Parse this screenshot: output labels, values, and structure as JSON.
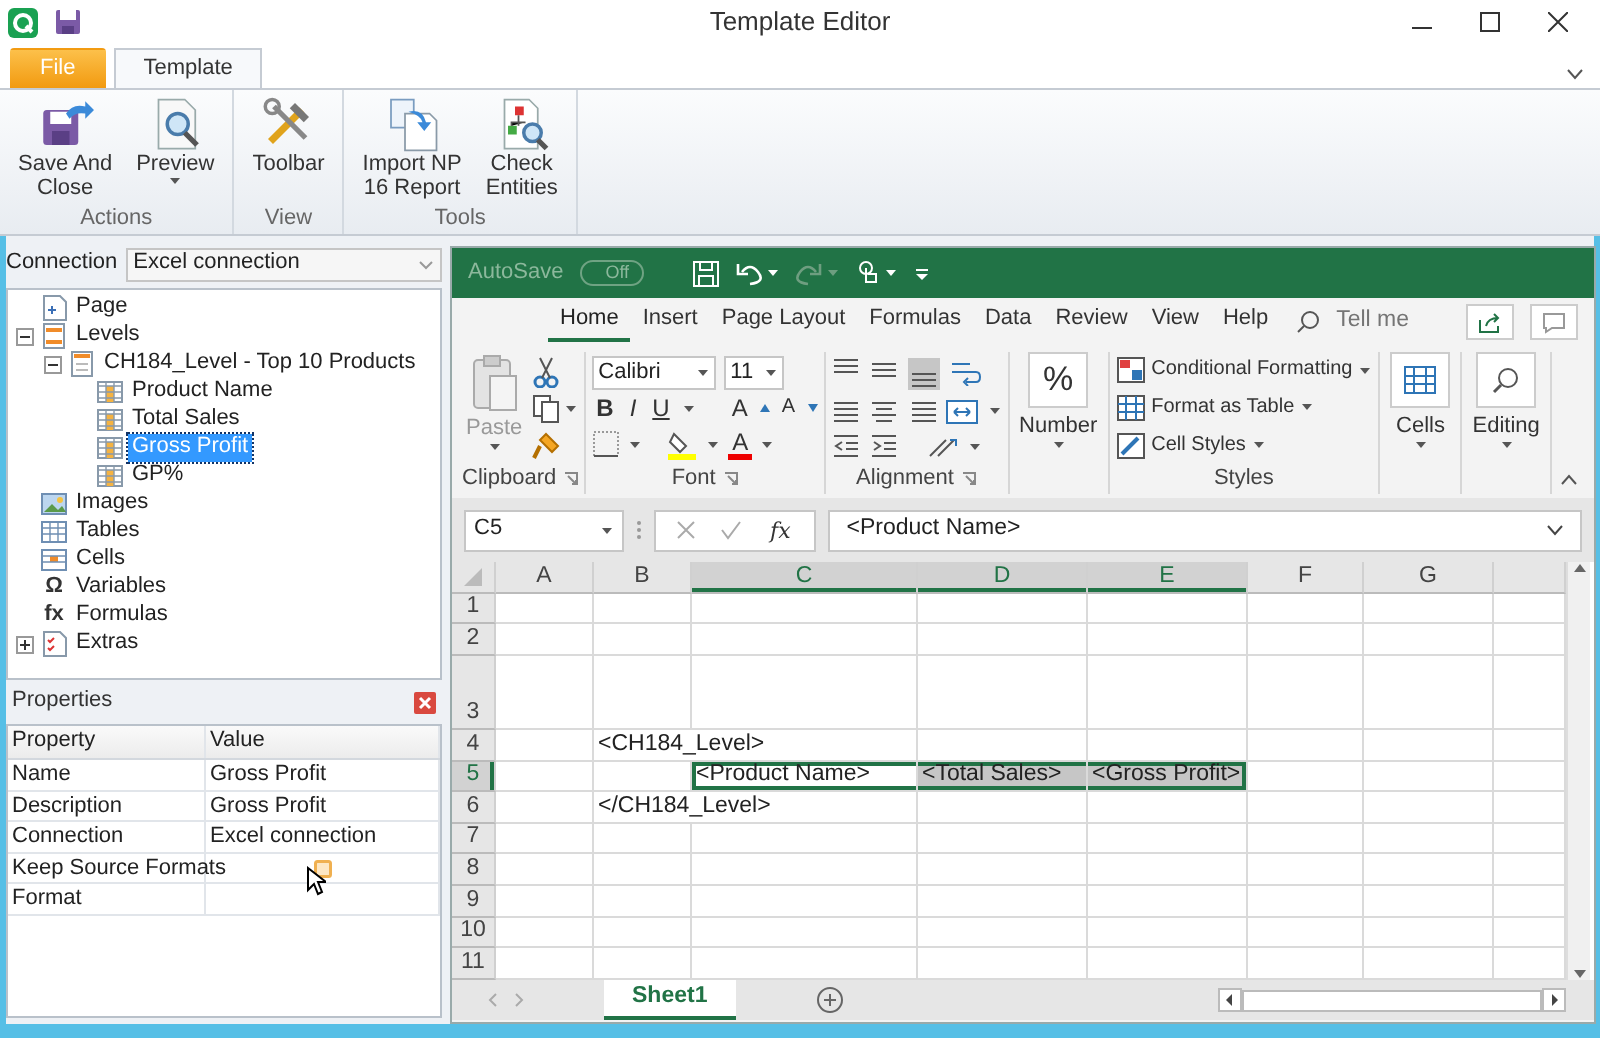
{
  "window": {
    "title": "Template Editor"
  },
  "ribbon": {
    "tabs": [
      {
        "label": "File",
        "kind": "file",
        "selected": false
      },
      {
        "label": "Template",
        "kind": "tab",
        "selected": true
      }
    ],
    "groups": [
      {
        "label": "Actions",
        "buttons": [
          {
            "label": "Save And\nClose",
            "kind": "save-close",
            "dropdown": false
          },
          {
            "label": "Preview",
            "kind": "preview",
            "dropdown": true
          }
        ]
      },
      {
        "label": "View",
        "buttons": [
          {
            "label": "Toolbar",
            "kind": "toolbar",
            "dropdown": false
          }
        ]
      },
      {
        "label": "Tools",
        "buttons": [
          {
            "label": "Import NP\n16 Report",
            "kind": "import",
            "dropdown": false
          },
          {
            "label": "Check\nEntities",
            "kind": "check",
            "dropdown": false
          }
        ]
      }
    ]
  },
  "connection": {
    "label": "Connection",
    "value": "Excel connection"
  },
  "tree": [
    {
      "label": "Page",
      "kind": "page",
      "selected": false
    },
    {
      "label": "Levels",
      "kind": "levels",
      "selected": false,
      "expanded": true,
      "children": [
        {
          "label": "CH184_Level - Top 10 Products",
          "kind": "level",
          "selected": false,
          "expanded": true,
          "children": [
            {
              "label": "Product Name",
              "kind": "field",
              "selected": false
            },
            {
              "label": "Total Sales",
              "kind": "field",
              "selected": false
            },
            {
              "label": "Gross Profit",
              "kind": "field",
              "selected": true
            },
            {
              "label": "GP%",
              "kind": "field",
              "selected": false
            }
          ]
        }
      ]
    },
    {
      "label": "Images",
      "kind": "images",
      "selected": false
    },
    {
      "label": "Tables",
      "kind": "tables",
      "selected": false
    },
    {
      "label": "Cells",
      "kind": "cells",
      "selected": false
    },
    {
      "label": "Variables",
      "kind": "glyph",
      "glyph": "Ω",
      "selected": false
    },
    {
      "label": "Formulas",
      "kind": "glyph",
      "glyph": "fx",
      "selected": false
    },
    {
      "label": "Extras",
      "kind": "extras",
      "selected": false,
      "expanded": false
    }
  ],
  "properties": {
    "title": "Properties",
    "columns": [
      "Property",
      "Value"
    ],
    "rows": [
      {
        "name": "Name",
        "kind": "text",
        "value": "Gross Profit"
      },
      {
        "name": "Description",
        "kind": "text",
        "value": "Gross Profit"
      },
      {
        "name": "Connection",
        "kind": "text",
        "value": "Excel connection"
      },
      {
        "name": "Keep Source Formats",
        "kind": "checkbox",
        "checked": false
      },
      {
        "name": "Format",
        "kind": "text"
      }
    ]
  },
  "excel": {
    "autosave": {
      "label": "AutoSave",
      "state": "Off",
      "on": false
    },
    "tabs": [
      {
        "label": "Home",
        "selected": true
      },
      {
        "label": "Insert",
        "selected": false
      },
      {
        "label": "Page Layout",
        "selected": false
      },
      {
        "label": "Formulas",
        "selected": false
      },
      {
        "label": "Data",
        "selected": false
      },
      {
        "label": "Review",
        "selected": false
      },
      {
        "label": "View",
        "selected": false
      },
      {
        "label": "Help",
        "selected": false
      }
    ],
    "tell_me": {
      "placeholder": "Tell me"
    },
    "clipboard": {
      "label": "Clipboard",
      "paste": "Paste",
      "paste_disabled": true
    },
    "font": {
      "label": "Font",
      "name": "Calibri",
      "size": "11",
      "style_buttons": [
        "B",
        "I",
        "U"
      ],
      "grow": "A",
      "shrink": "A",
      "color_button": "A"
    },
    "alignment": {
      "label": "Alignment"
    },
    "number": {
      "symbol": "%",
      "label": "Number"
    },
    "styles": {
      "label": "Styles",
      "items": [
        {
          "label": "Conditional Formatting",
          "kind": "conditional"
        },
        {
          "label": "Format as Table",
          "kind": "table"
        },
        {
          "label": "Cell Styles",
          "kind": "styles"
        }
      ]
    },
    "cells_button": "Cells",
    "editing_button": "Editing",
    "formula_bar": {
      "name_box": "C5",
      "fx": "fx",
      "value": "<Product Name>"
    },
    "grid": {
      "columns": [
        {
          "label": "A",
          "selected": false
        },
        {
          "label": "B",
          "selected": false
        },
        {
          "label": "C",
          "selected": true
        },
        {
          "label": "D",
          "selected": true
        },
        {
          "label": "E",
          "selected": true
        },
        {
          "label": "F",
          "selected": false
        },
        {
          "label": "G",
          "selected": false
        }
      ],
      "rows": [
        {
          "label": "1",
          "selected": false,
          "cells": [
            null,
            null,
            null,
            null,
            null,
            null,
            null
          ]
        },
        {
          "label": "2",
          "selected": false,
          "cells": [
            null,
            null,
            null,
            null,
            null,
            null,
            null
          ]
        },
        {
          "label": "3",
          "selected": false,
          "cells": [
            null,
            null,
            null,
            null,
            null,
            null,
            null
          ]
        },
        {
          "label": "4",
          "selected": false,
          "cells": [
            null,
            {
              "text": "<CH184_Level>",
              "shaded": false
            },
            null,
            null,
            null,
            null,
            null
          ]
        },
        {
          "label": "5",
          "selected": true,
          "cells": [
            null,
            null,
            {
              "text": "<Product Name>",
              "shaded": false
            },
            {
              "text": "<Total Sales>",
              "shaded": true
            },
            {
              "text": "<Gross Profit>",
              "shaded": true
            },
            null,
            null
          ]
        },
        {
          "label": "6",
          "selected": false,
          "cells": [
            null,
            {
              "text": "</CH184_Level>",
              "shaded": false
            },
            null,
            null,
            null,
            null,
            null
          ]
        },
        {
          "label": "7",
          "selected": false,
          "cells": [
            null,
            null,
            null,
            null,
            null,
            null,
            null
          ]
        },
        {
          "label": "8",
          "selected": false,
          "cells": [
            null,
            null,
            null,
            null,
            null,
            null,
            null
          ]
        },
        {
          "label": "9",
          "selected": false,
          "cells": [
            null,
            null,
            null,
            null,
            null,
            null,
            null
          ]
        },
        {
          "label": "10",
          "selected": false,
          "cells": [
            null,
            null,
            null,
            null,
            null,
            null,
            null
          ]
        },
        {
          "label": "11",
          "selected": false,
          "cells": [
            null,
            null,
            null,
            null,
            null,
            null,
            null
          ]
        }
      ]
    },
    "sheets": [
      {
        "label": "Sheet1",
        "selected": true
      }
    ]
  }
}
